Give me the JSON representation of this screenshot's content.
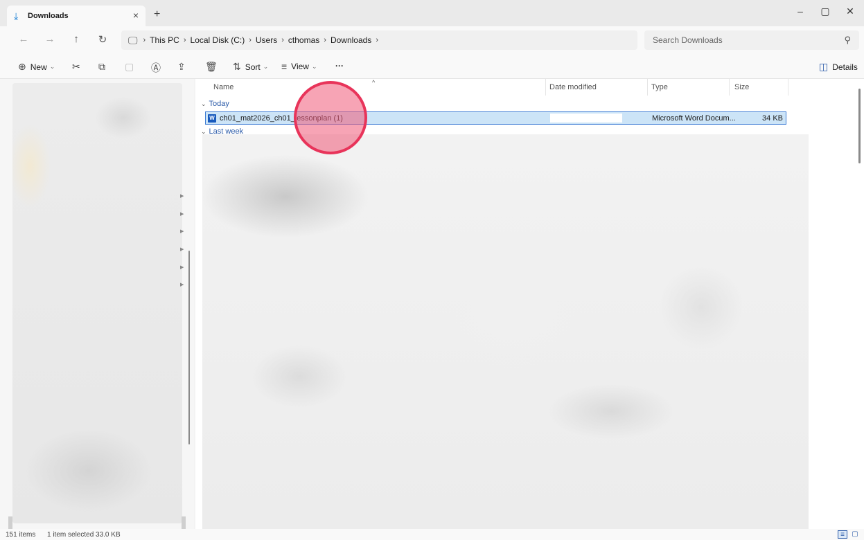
{
  "window": {
    "tab_title": "Downloads",
    "tab_close": "×",
    "new_tab": "+",
    "minimize": "–",
    "restore": "▢",
    "close": "✕"
  },
  "nav": {
    "back": "←",
    "forward": "→",
    "up": "↑",
    "refresh": "↻"
  },
  "breadcrumb": [
    "This PC",
    "Local Disk (C:)",
    "Users",
    "cthomas",
    "Downloads"
  ],
  "breadcrumb_sep": "›",
  "search": {
    "placeholder": "Search Downloads"
  },
  "toolbar": {
    "new_label": "New",
    "sort_label": "Sort",
    "view_label": "View",
    "more_label": "···",
    "details_label": "Details"
  },
  "columns": {
    "name": "Name",
    "date_modified": "Date modified",
    "type": "Type",
    "size": "Size"
  },
  "groups": {
    "today": "Today",
    "last_week": "Last week"
  },
  "selected_file": {
    "name": "ch01_mat2026_ch01_lessonplan (1)",
    "icon_letter": "W",
    "type": "Microsoft Word Docum...",
    "size": "34 KB"
  },
  "status": {
    "item_count": "151 items",
    "selection": "1 item selected 33.0 KB"
  },
  "icons": {
    "download": "download-icon",
    "pc": "pc-icon",
    "search": "search-icon",
    "word": "word-document-icon"
  },
  "colors": {
    "accent": "#1a7fd4",
    "selection_bg": "#cce4f7",
    "selection_border": "#3a7ad3",
    "click_marker": "#e8345a"
  }
}
